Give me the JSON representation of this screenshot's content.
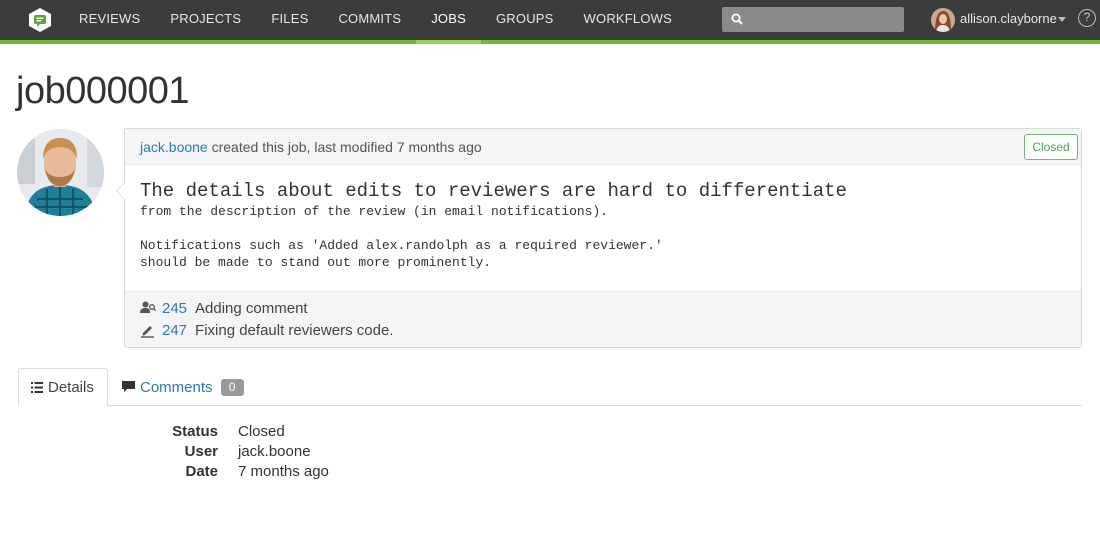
{
  "nav": {
    "items": [
      "REVIEWS",
      "PROJECTS",
      "FILES",
      "COMMITS",
      "JOBS",
      "GROUPS",
      "WORKFLOWS"
    ],
    "active": "JOBS",
    "search": {
      "placeholder": "",
      "value": ""
    },
    "user": "allison.clayborne",
    "help": "?"
  },
  "page": {
    "title": "job000001"
  },
  "job": {
    "author": "jack.boone",
    "meta": "created this job, last modified 7 months ago",
    "status": "Closed",
    "description_first": "The details about edits to reviewers are hard to differentiate",
    "description_rest": "from the description of the review (in email notifications).\n\nNotifications such as 'Added alex.randolph as a required reviewer.'\nshould be made to stand out more prominently.",
    "fixes": [
      {
        "icon": "review-icon",
        "number": "245",
        "text": "Adding comment"
      },
      {
        "icon": "commit-icon",
        "number": "247",
        "text": "Fixing default reviewers code."
      }
    ]
  },
  "tabs": {
    "details": {
      "label": "Details",
      "icon": "list-icon"
    },
    "comments": {
      "label": "Comments",
      "icon": "comment-icon",
      "count": "0"
    }
  },
  "details": {
    "rows": [
      {
        "label": "Status",
        "value": "Closed"
      },
      {
        "label": "User",
        "value": "jack.boone"
      },
      {
        "label": "Date",
        "value": "7 months ago"
      }
    ]
  },
  "colors": {
    "accent": "#6fbb2e",
    "link": "#2b7bb9",
    "navbar": "#3c3c3c",
    "closed": "#4aa84a"
  }
}
